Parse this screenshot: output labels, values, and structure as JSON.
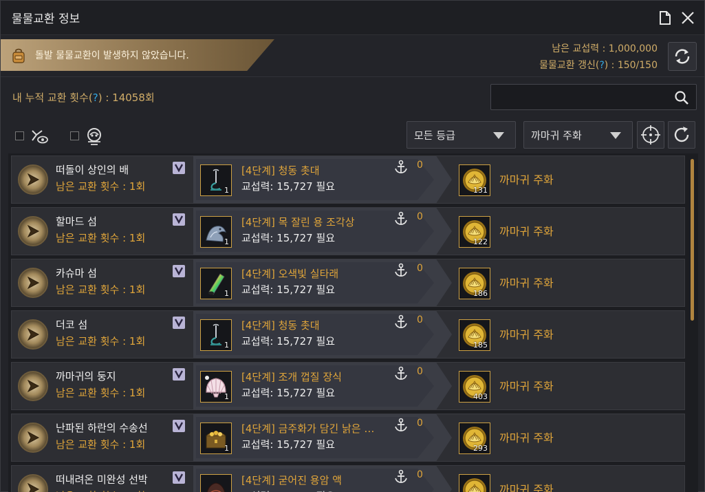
{
  "window": {
    "title": "물물교환 정보"
  },
  "alert": {
    "text": "돌발 물물교환이 발생하지 않았습니다."
  },
  "stats": {
    "remaining_power_label": "남은 교섭력 : 1,000,000",
    "refresh_label_pre": "물물교환 갱신(",
    "refresh_help": "?",
    "refresh_label_post": ") : 150/150"
  },
  "cumulative": {
    "label_pre": "내 누적 교환 횟수(",
    "help": "?",
    "label_post": ") : 14058회"
  },
  "search": {
    "value": "",
    "placeholder": ""
  },
  "filters": {
    "grade_dropdown": "모든 등급",
    "currency_dropdown": "까마귀 주화"
  },
  "rows": [
    {
      "npc": "떠돌이 상인의 배",
      "remain": "남은 교환 횟수 : 1회",
      "item": "[4단계] 청동 촛대",
      "item_icon": "candlestick-icon",
      "item_count": "1",
      "req": "교섭력: 15,727 필요",
      "anchor": "0",
      "reward_count": "131",
      "reward": "까마귀 주화"
    },
    {
      "npc": "할마드 섬",
      "remain": "남은 교환 횟수 : 1회",
      "item": "[4단계] 목 잘린 용 조각상",
      "item_icon": "dragon-statue-icon",
      "item_count": "1",
      "req": "교섭력: 15,727 필요",
      "anchor": "0",
      "reward_count": "122",
      "reward": "까마귀 주화"
    },
    {
      "npc": "카슈마 섬",
      "remain": "남은 교환 횟수 : 1회",
      "item": "[4단계] 오색빛 실타래",
      "item_icon": "thread-spool-icon",
      "item_count": "1",
      "req": "교섭력: 15,727 필요",
      "anchor": "0",
      "reward_count": "186",
      "reward": "까마귀 주화"
    },
    {
      "npc": "더코 섬",
      "remain": "남은 교환 횟수 : 1회",
      "item": "[4단계] 청동 촛대",
      "item_icon": "candlestick-icon",
      "item_count": "1",
      "req": "교섭력: 15,727 필요",
      "anchor": "0",
      "reward_count": "185",
      "reward": "까마귀 주화"
    },
    {
      "npc": "까마귀의 둥지",
      "remain": "남은 교환 횟수 : 1회",
      "item": "[4단계] 조개 껍질 장식",
      "item_icon": "seashell-icon",
      "item_count": "1",
      "req": "교섭력: 15,727 필요",
      "anchor": "0",
      "reward_count": "403",
      "reward": "까마귀 주화"
    },
    {
      "npc": "난파된 하란의 수송선",
      "remain": "남은 교환 횟수 : 1회",
      "item": "[4단계] 금주화가 담긴 낡은 …",
      "item_icon": "treasure-chest-icon",
      "item_count": "1",
      "req": "교섭력: 15,727 필요",
      "anchor": "0",
      "reward_count": "293",
      "reward": "까마귀 주화"
    },
    {
      "npc": "떠내려온 미완성 선박",
      "remain": "남은 교환 횟수 : 1회",
      "item": "[4단계] 굳어진 용암 액",
      "item_icon": "lava-icon",
      "item_count": "1",
      "req": "교섭력: 15,727 필요",
      "anchor": "0",
      "reward_count": "",
      "reward": "까마귀 주화"
    }
  ],
  "colors": {
    "accent_gold": "#e0a53a",
    "help_blue": "#34a8e0",
    "banner": "#bca27a"
  }
}
